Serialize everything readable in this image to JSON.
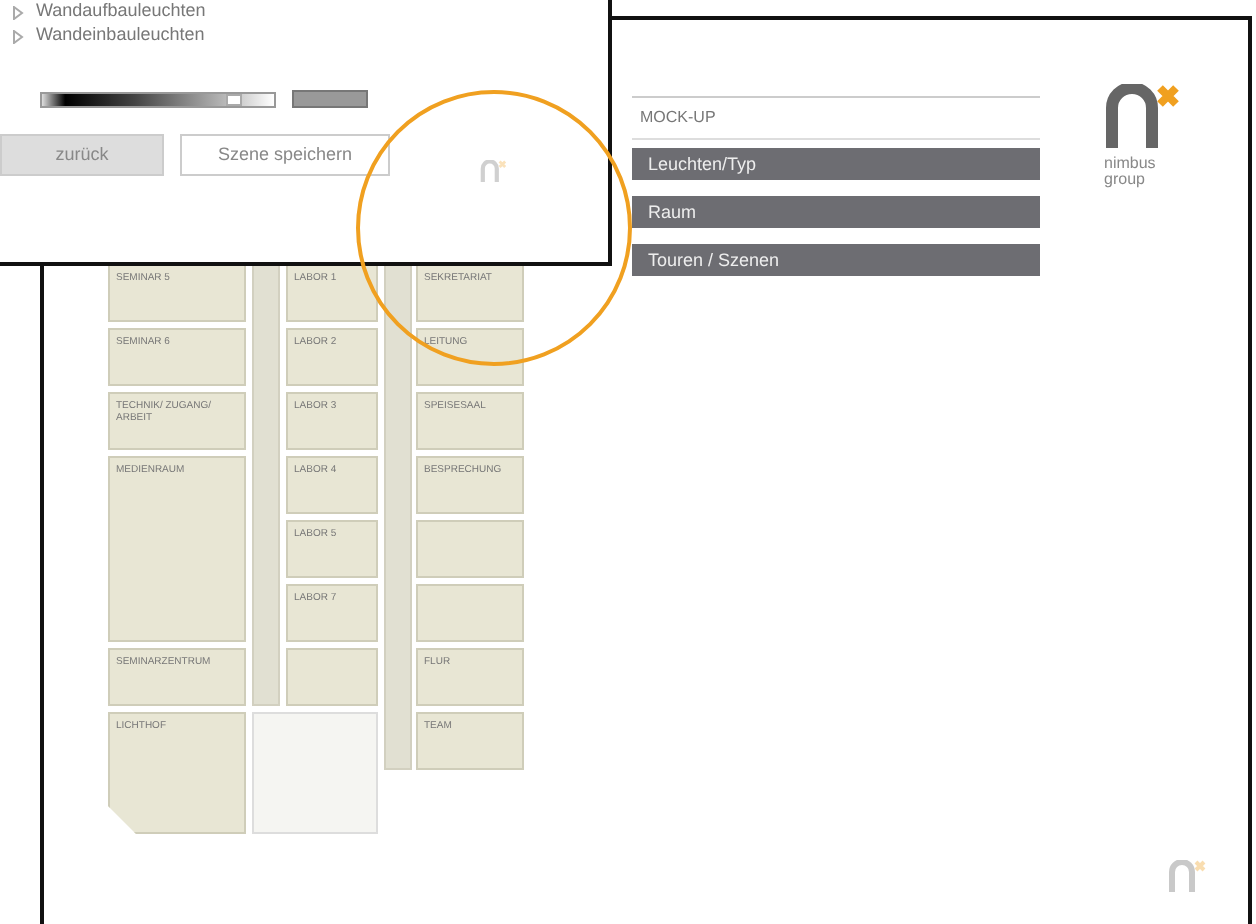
{
  "panel": {
    "items": [
      {
        "label": "Wandaufbauleuchten",
        "kind": "item"
      },
      {
        "label": "Wandeinbauleuchten",
        "kind": "item"
      }
    ],
    "brightness": {
      "level": 0.85
    },
    "buttons": [
      {
        "label": "zurück",
        "kind": "filled"
      },
      {
        "label": "Szene speichern",
        "kind": "outline"
      }
    ]
  },
  "main": {
    "title": "MOCK-UP",
    "menu": [
      {
        "label": "Leuchten/Typ"
      },
      {
        "label": "Raum"
      },
      {
        "label": "Touren / Szenen"
      }
    ],
    "logo": {
      "text": "nimbus group"
    },
    "floor_plan": {
      "columns": [
        {
          "rooms": [
            {
              "kind": "room",
              "label": "SEMINAR 5"
            },
            {
              "kind": "room",
              "label": "SEMINAR 6"
            },
            {
              "kind": "room",
              "label": "TECHNIK/ ZUGANG/ ARBEIT"
            },
            {
              "kind": "room",
              "label": "MEDIENRAUM"
            },
            {
              "kind": "room",
              "label": "SEMINARZENTRUM"
            },
            {
              "kind": "room",
              "label": "LICHTHOF"
            }
          ]
        },
        {
          "rooms": [
            {
              "kind": "room",
              "label": "LABOR 1"
            },
            {
              "kind": "room",
              "label": "LABOR 2"
            },
            {
              "kind": "room",
              "label": "LABOR 3"
            },
            {
              "kind": "room",
              "label": "LABOR 4"
            },
            {
              "kind": "room",
              "label": "LABOR 5"
            },
            {
              "kind": "room",
              "label": "LABOR 7"
            },
            {
              "kind": "room"
            },
            {
              "kind": "stair"
            }
          ]
        },
        {
          "rooms": [
            {
              "kind": "room",
              "label": "SEKRETARIAT"
            },
            {
              "kind": "room",
              "label": "LEITUNG"
            },
            {
              "kind": "room",
              "label": "SPEISESAAL"
            },
            {
              "kind": "room",
              "label": "BESPRECHUNG"
            },
            {
              "kind": "room"
            },
            {
              "kind": "room"
            },
            {
              "kind": "room",
              "label": "FLUR"
            },
            {
              "kind": "room",
              "label": "TEAM"
            }
          ]
        }
      ]
    }
  },
  "annotation": {
    "kind": "circle"
  }
}
